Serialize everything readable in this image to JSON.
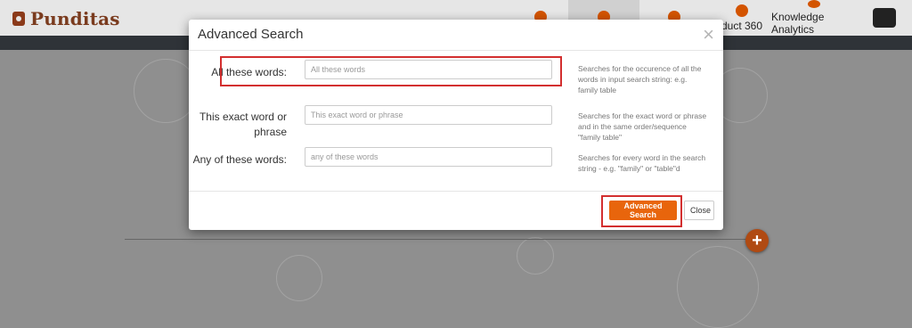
{
  "app": {
    "brand": "Punditas"
  },
  "nav": {
    "items": [
      {
        "label": "",
        "icon": "speedometer-icon"
      },
      {
        "label": "",
        "icon": "network-icon"
      },
      {
        "label": "",
        "icon": "bulb-icon"
      },
      {
        "label": "duct 360",
        "icon": "radar-icon"
      },
      {
        "label": "Knowledge Analytics",
        "icon": "lightbulb-head-icon"
      }
    ]
  },
  "modal": {
    "title": "Advanced Search",
    "close_icon": "close-icon",
    "rows": [
      {
        "label": "All these words:",
        "placeholder": "All these words",
        "help": "Searches for the occurence of all the words in input search string: e.g. family table"
      },
      {
        "label": "This exact word or phrase",
        "placeholder": "This exact word or phrase",
        "help": "Searches for the exact word or phrase and in the same order/sequence \"family table\""
      },
      {
        "label": "Any of these words:",
        "placeholder": "any of these words",
        "help": "Searches for every word in the search string - e.g. \"family\" or \"table\"d"
      }
    ],
    "buttons": {
      "advanced_search": "Advanced Search",
      "close": "Close"
    }
  },
  "fab": {
    "label": "+"
  },
  "colors": {
    "accent": "#e8650c",
    "brand": "#7a3b1e",
    "highlight": "#d32f2f"
  }
}
